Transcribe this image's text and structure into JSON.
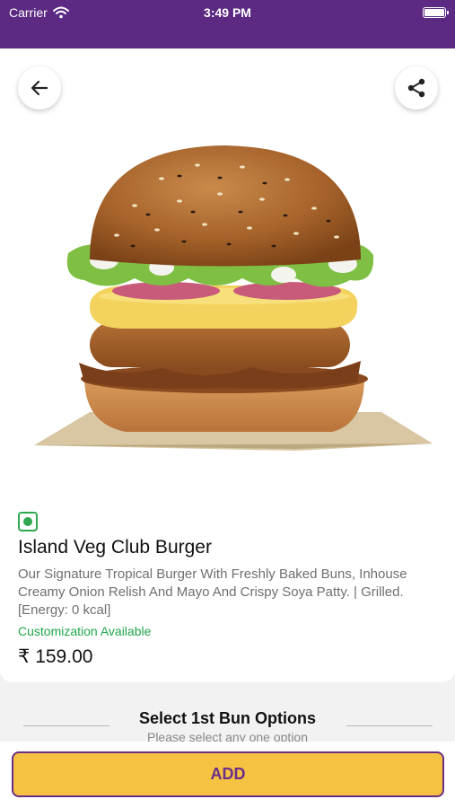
{
  "status_bar": {
    "carrier": "Carrier",
    "time": "3:49 PM"
  },
  "icons": {
    "back": "back-arrow-icon",
    "share": "share-icon",
    "wifi": "wifi-icon",
    "battery": "battery-icon",
    "veg": "veg-indicator-icon"
  },
  "product": {
    "name": "Island Veg Club Burger",
    "description": "Our Signature Tropical Burger With Freshly Baked Buns, Inhouse Creamy Onion Relish And Mayo And Crispy Soya Patty. | Grilled.[Energy: 0 kcal]",
    "customization": "Customization Available",
    "price": "₹ 159.00"
  },
  "options_section": {
    "title": "Select 1st Bun Options",
    "subtitle": "Please select any one option"
  },
  "footer": {
    "add_label": "ADD"
  },
  "colors": {
    "brand_purple": "#5c2a82",
    "add_yellow": "#f5c242",
    "veg_green": "#2fa84f"
  }
}
